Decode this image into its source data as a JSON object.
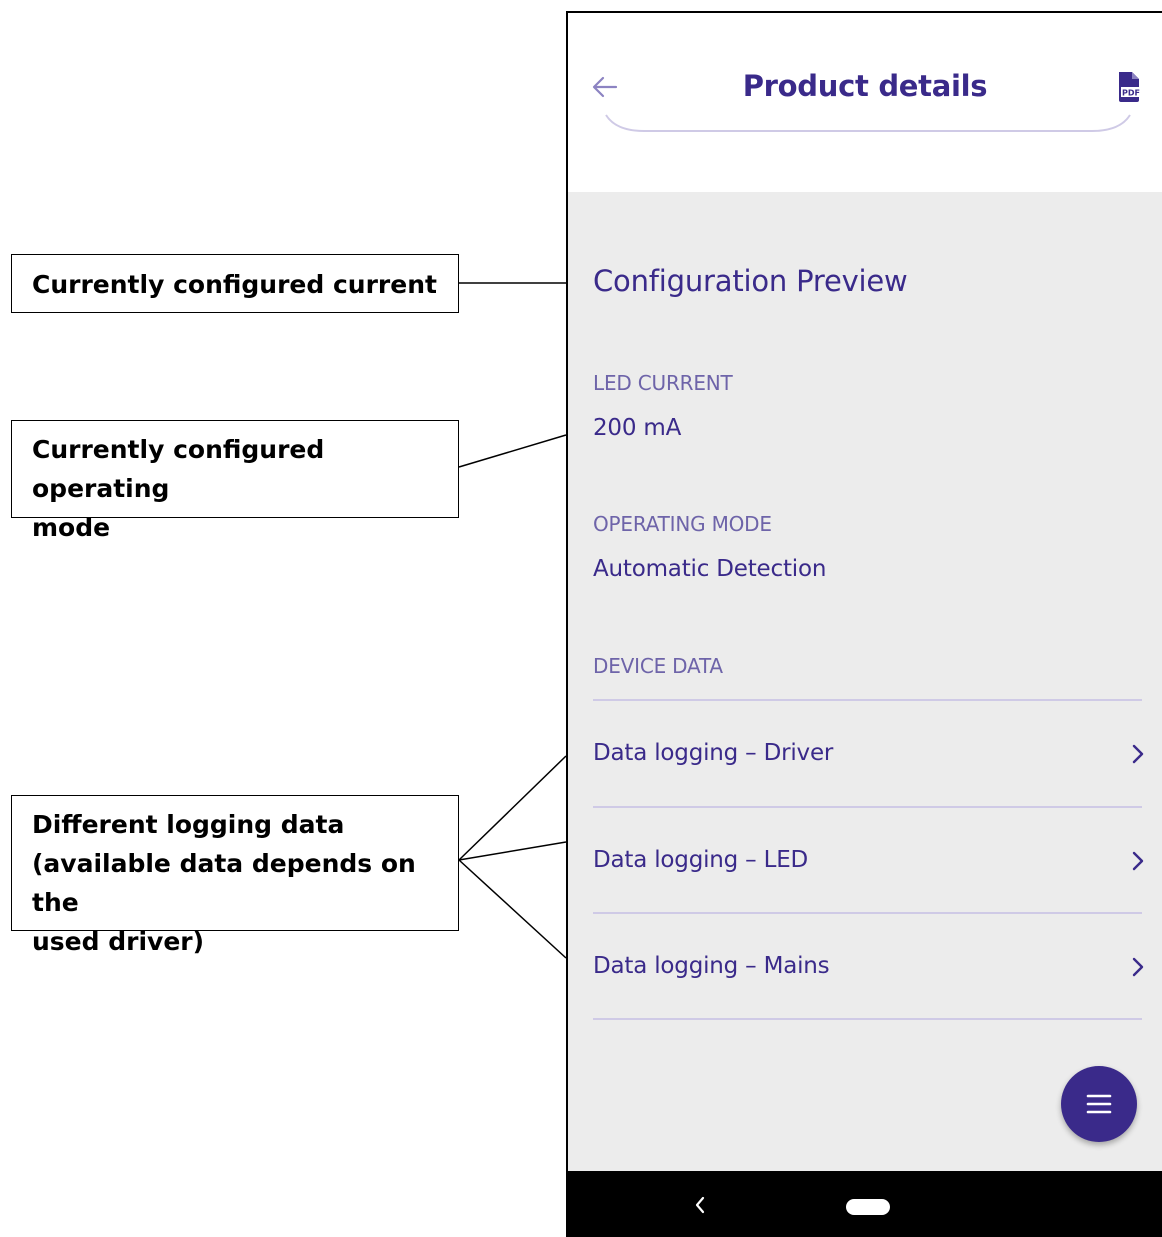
{
  "callouts": {
    "current": "Currently configured current",
    "mode_line1": "Currently configured operating",
    "mode_line2": "mode",
    "logging_line1": "Different logging data",
    "logging_line2": "(available data depends on the",
    "logging_line3": "used driver)"
  },
  "appbar": {
    "title": "Product details",
    "back_icon": "arrow-left-icon",
    "pdf_icon": "pdf-icon",
    "pdf_text": "PDF"
  },
  "config": {
    "section_title": "Configuration Preview",
    "led_current_label": "LED CURRENT",
    "led_current_value": "200 mA",
    "operating_mode_label": "OPERATING MODE",
    "operating_mode_value": "Automatic Detection",
    "device_data_label": "DEVICE DATA"
  },
  "device_data": {
    "items": [
      {
        "label": "Data logging – Driver"
      },
      {
        "label": "Data logging – LED"
      },
      {
        "label": "Data logging – Mains"
      }
    ]
  },
  "fab": {
    "icon": "menu-icon"
  },
  "colors": {
    "primary": "#3a2a8a",
    "label": "#6e64a9",
    "background": "#ececec",
    "divider": "#cfcae6"
  }
}
